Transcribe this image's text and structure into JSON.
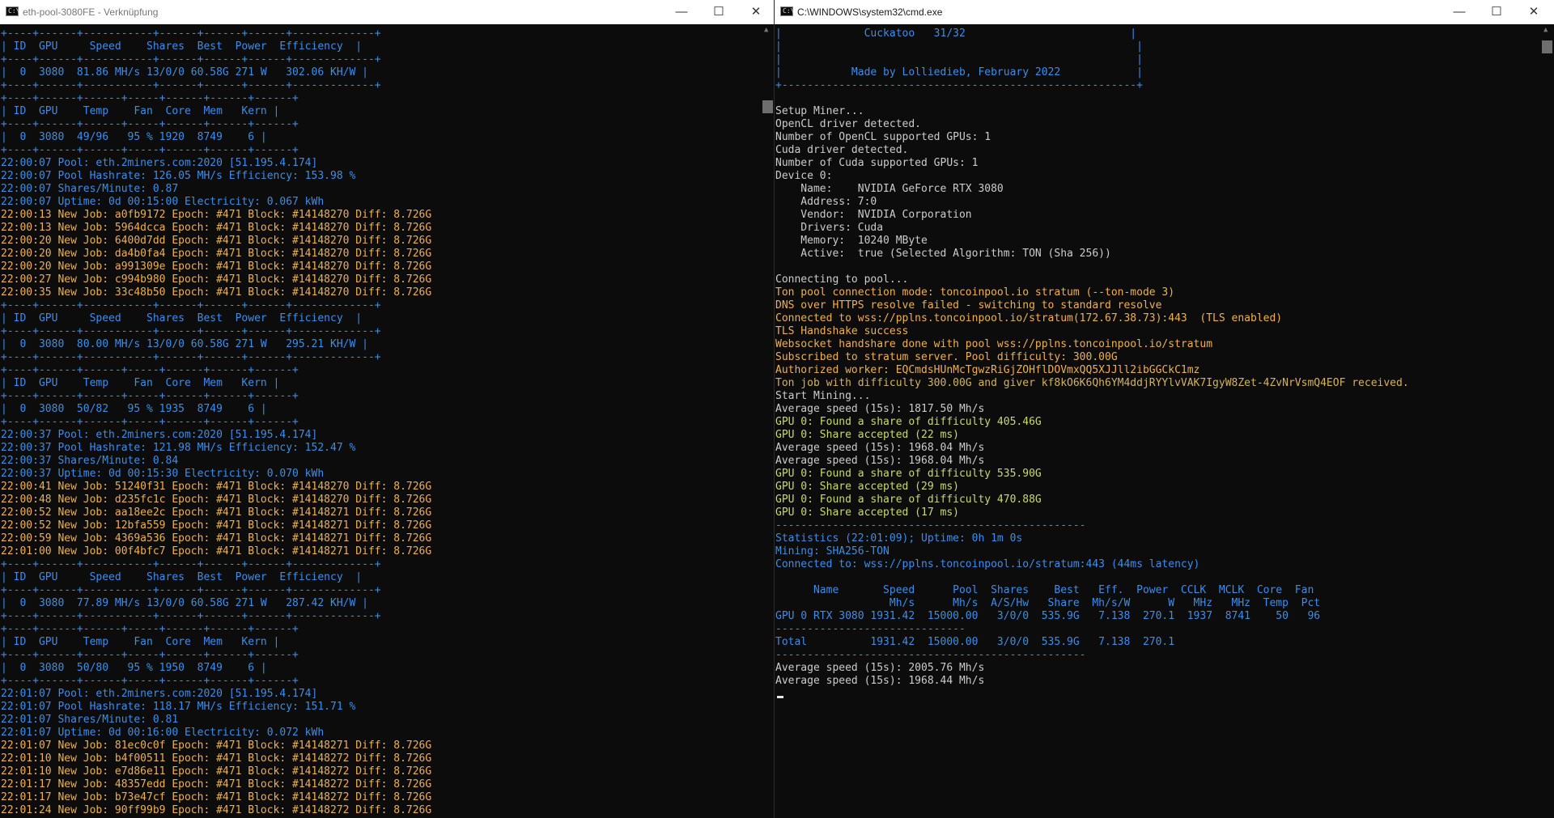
{
  "left_window": {
    "title": "eth-pool-3080FE - Verknüpfung",
    "controls": {
      "minimize": "—",
      "maximize": "☐",
      "close": "✕"
    },
    "lines": [
      {
        "t": "+----+------+-----------+------+------+------+-------------+",
        "c": "blue"
      },
      {
        "t": "| ID  GPU     Speed    Shares  Best  Power  Efficiency  |",
        "c": "blue"
      },
      {
        "t": "+----+------+-----------+------+------+------+-------------+",
        "c": "blue"
      },
      {
        "t": "|  0  3080  81.86 MH/s 13/0/0 60.58G 271 W   302.06 KH/W |",
        "c": "blue"
      },
      {
        "t": "+----+------+-----------+------+------+------+-------------+",
        "c": "blue"
      },
      {
        "t": "+----+------+------+-----+------+------+------+",
        "c": "blue"
      },
      {
        "t": "| ID  GPU    Temp    Fan  Core  Mem   Kern |",
        "c": "blue"
      },
      {
        "t": "+----+------+------+-----+------+------+------+",
        "c": "blue"
      },
      {
        "t": "|  0  3080  49/96   95 % 1920  8749    6 |",
        "c": "blue"
      },
      {
        "t": "+----+------+------+-----+------+------+------+",
        "c": "blue"
      },
      {
        "t": "22:00:07 Pool: eth.2miners.com:2020 [51.195.4.174]",
        "c": "blue"
      },
      {
        "t": "22:00:07 Pool Hashrate: 126.05 MH/s Efficiency: 153.98 %",
        "c": "blue"
      },
      {
        "t": "22:00:07 Shares/Minute: 0.87",
        "c": "blue"
      },
      {
        "t": "22:00:07 Uptime: 0d 00:15:00 Electricity: 0.067 kWh",
        "c": "blue"
      },
      {
        "t": "22:00:13 New Job: a0fb9172 Epoch: #471 Block: #14148270 Diff: 8.726G",
        "c": "yellow"
      },
      {
        "t": "22:00:13 New Job: 5964dcca Epoch: #471 Block: #14148270 Diff: 8.726G",
        "c": "yellow"
      },
      {
        "t": "22:00:20 New Job: 6400d7dd Epoch: #471 Block: #14148270 Diff: 8.726G",
        "c": "yellow"
      },
      {
        "t": "22:00:20 New Job: da4b0fa4 Epoch: #471 Block: #14148270 Diff: 8.726G",
        "c": "yellow"
      },
      {
        "t": "22:00:20 New Job: a991309e Epoch: #471 Block: #14148270 Diff: 8.726G",
        "c": "yellow"
      },
      {
        "t": "22:00:27 New Job: c994b980 Epoch: #471 Block: #14148270 Diff: 8.726G",
        "c": "yellow"
      },
      {
        "t": "22:00:35 New Job: 33c48b50 Epoch: #471 Block: #14148270 Diff: 8.726G",
        "c": "yellow"
      },
      {
        "t": "+----+------+-----------+------+------+------+-------------+",
        "c": "blue"
      },
      {
        "t": "| ID  GPU     Speed    Shares  Best  Power  Efficiency  |",
        "c": "blue"
      },
      {
        "t": "+----+------+-----------+------+------+------+-------------+",
        "c": "blue"
      },
      {
        "t": "|  0  3080  80.00 MH/s 13/0/0 60.58G 271 W   295.21 KH/W |",
        "c": "blue"
      },
      {
        "t": "+----+------+-----------+------+------+------+-------------+",
        "c": "blue"
      },
      {
        "t": "+----+------+------+-----+------+------+------+",
        "c": "blue"
      },
      {
        "t": "| ID  GPU    Temp    Fan  Core  Mem   Kern |",
        "c": "blue"
      },
      {
        "t": "+----+------+------+-----+------+------+------+",
        "c": "blue"
      },
      {
        "t": "|  0  3080  50/82   95 % 1935  8749    6 |",
        "c": "blue"
      },
      {
        "t": "+----+------+------+-----+------+------+------+",
        "c": "blue"
      },
      {
        "t": "22:00:37 Pool: eth.2miners.com:2020 [51.195.4.174]",
        "c": "blue"
      },
      {
        "t": "22:00:37 Pool Hashrate: 121.98 MH/s Efficiency: 152.47 %",
        "c": "blue"
      },
      {
        "t": "22:00:37 Shares/Minute: 0.84",
        "c": "blue"
      },
      {
        "t": "22:00:37 Uptime: 0d 00:15:30 Electricity: 0.070 kWh",
        "c": "blue"
      },
      {
        "t": "22:00:41 New Job: 51240f31 Epoch: #471 Block: #14148270 Diff: 8.726G",
        "c": "yellow"
      },
      {
        "t": "22:00:48 New Job: d235fc1c Epoch: #471 Block: #14148270 Diff: 8.726G",
        "c": "yellow"
      },
      {
        "t": "22:00:52 New Job: aa18ee2c Epoch: #471 Block: #14148271 Diff: 8.726G",
        "c": "yellow"
      },
      {
        "t": "22:00:52 New Job: 12bfa559 Epoch: #471 Block: #14148271 Diff: 8.726G",
        "c": "yellow"
      },
      {
        "t": "22:00:59 New Job: 4369a536 Epoch: #471 Block: #14148271 Diff: 8.726G",
        "c": "yellow"
      },
      {
        "t": "22:01:00 New Job: 00f4bfc7 Epoch: #471 Block: #14148271 Diff: 8.726G",
        "c": "yellow"
      },
      {
        "t": "+----+------+-----------+------+------+------+-------------+",
        "c": "blue"
      },
      {
        "t": "| ID  GPU     Speed    Shares  Best  Power  Efficiency  |",
        "c": "blue"
      },
      {
        "t": "+----+------+-----------+------+------+------+-------------+",
        "c": "blue"
      },
      {
        "t": "|  0  3080  77.89 MH/s 13/0/0 60.58G 271 W   287.42 KH/W |",
        "c": "blue"
      },
      {
        "t": "+----+------+-----------+------+------+------+-------------+",
        "c": "blue"
      },
      {
        "t": "+----+------+------+-----+------+------+------+",
        "c": "blue"
      },
      {
        "t": "| ID  GPU    Temp    Fan  Core  Mem   Kern |",
        "c": "blue"
      },
      {
        "t": "+----+------+------+-----+------+------+------+",
        "c": "blue"
      },
      {
        "t": "|  0  3080  50/80   95 % 1950  8749    6 |",
        "c": "blue"
      },
      {
        "t": "+----+------+------+-----+------+------+------+",
        "c": "blue"
      },
      {
        "t": "22:01:07 Pool: eth.2miners.com:2020 [51.195.4.174]",
        "c": "blue"
      },
      {
        "t": "22:01:07 Pool Hashrate: 118.17 MH/s Efficiency: 151.71 %",
        "c": "blue"
      },
      {
        "t": "22:01:07 Shares/Minute: 0.81",
        "c": "blue"
      },
      {
        "t": "22:01:07 Uptime: 0d 00:16:00 Electricity: 0.072 kWh",
        "c": "blue"
      },
      {
        "t": "22:01:07 New Job: 81ec0c0f Epoch: #471 Block: #14148271 Diff: 8.726G",
        "c": "yellow"
      },
      {
        "t": "22:01:10 New Job: b4f00511 Epoch: #471 Block: #14148272 Diff: 8.726G",
        "c": "yellow"
      },
      {
        "t": "22:01:10 New Job: e7d86e11 Epoch: #471 Block: #14148272 Diff: 8.726G",
        "c": "yellow"
      },
      {
        "t": "22:01:17 New Job: 48357edd Epoch: #471 Block: #14148272 Diff: 8.726G",
        "c": "yellow"
      },
      {
        "t": "22:01:17 New Job: b73e47cf Epoch: #471 Block: #14148272 Diff: 8.726G",
        "c": "yellow"
      },
      {
        "t": "22:01:24 New Job: 90ff99b9 Epoch: #471 Block: #14148272 Diff: 8.726G",
        "c": "yellow"
      }
    ]
  },
  "right_window": {
    "title": "C:\\WINDOWS\\system32\\cmd.exe",
    "controls": {
      "minimize": "—",
      "maximize": "☐",
      "close": "✕"
    },
    "lines": [
      {
        "t": "|             Cuckatoo   31/32                          |",
        "c": "blue"
      },
      {
        "t": "|                                                        |",
        "c": "blue"
      },
      {
        "t": "|                                                        |",
        "c": "blue"
      },
      {
        "t": "|           Made by Lolliedieb, February 2022            |",
        "c": "blue"
      },
      {
        "t": "+--------------------------------------------------------+",
        "c": "blue"
      },
      {
        "t": "",
        "c": "grey"
      },
      {
        "t": "Setup Miner...",
        "c": "grey"
      },
      {
        "t": "OpenCL driver detected.",
        "c": "grey"
      },
      {
        "t": "Number of OpenCL supported GPUs: 1",
        "c": "grey"
      },
      {
        "t": "Cuda driver detected.",
        "c": "grey"
      },
      {
        "t": "Number of Cuda supported GPUs: 1",
        "c": "grey"
      },
      {
        "t": "Device 0:",
        "c": "grey"
      },
      {
        "t": "    Name:    NVIDIA GeForce RTX 3080",
        "c": "grey"
      },
      {
        "t": "    Address: 7:0",
        "c": "grey"
      },
      {
        "t": "    Vendor:  NVIDIA Corporation",
        "c": "grey"
      },
      {
        "t": "    Drivers: Cuda",
        "c": "grey"
      },
      {
        "t": "    Memory:  10240 MByte",
        "c": "grey"
      },
      {
        "t": "    Active:  true (Selected Algorithm: TON (Sha 256))",
        "c": "grey"
      },
      {
        "t": "",
        "c": "grey"
      },
      {
        "t": "Connecting to pool...",
        "c": "grey"
      },
      {
        "t": "Ton pool connection mode: toncoinpool.io stratum (--ton-mode 3)",
        "c": "yellow"
      },
      {
        "t": "DNS over HTTPS resolve failed - switching to standard resolve",
        "c": "yellow"
      },
      {
        "t": "Connected to wss://pplns.toncoinpool.io/stratum(172.67.38.73):443  (TLS enabled)",
        "c": "yellow"
      },
      {
        "t": "TLS Handshake success",
        "c": "yellow"
      },
      {
        "t": "Websocket handshare done with pool wss://pplns.toncoinpool.io/stratum",
        "c": "yellow"
      },
      {
        "t": "Subscribed to stratum server. Pool difficulty: 300.00G",
        "c": "yellow"
      },
      {
        "t": "Authorized worker: EQCmdsHUnMcTgwzRiGjZOHflDOVmxQQ5XJJll2ibGGCkC1mz",
        "c": "yellow"
      },
      {
        "t": "Ton job with difficulty 300.00G and giver kf8kO6K6Qh6YM4ddjRYYlvVAK7IgyW8Zet-4ZvNrVsmQ4EOF received.",
        "c": "orange"
      },
      {
        "t": "Start Mining...",
        "c": "grey"
      },
      {
        "t": "Average speed (15s): 1817.50 Mh/s",
        "c": "grey"
      },
      {
        "t": "GPU 0: Found a share of difficulty 405.46G",
        "c": "lime"
      },
      {
        "t": "GPU 0: Share accepted (22 ms)",
        "c": "lime"
      },
      {
        "t": "Average speed (15s): 1968.04 Mh/s",
        "c": "grey"
      },
      {
        "t": "Average speed (15s): 1968.04 Mh/s",
        "c": "grey"
      },
      {
        "t": "GPU 0: Found a share of difficulty 535.90G",
        "c": "lime"
      },
      {
        "t": "GPU 0: Share accepted (29 ms)",
        "c": "lime"
      },
      {
        "t": "GPU 0: Found a share of difficulty 470.88G",
        "c": "lime"
      },
      {
        "t": "GPU 0: Share accepted (17 ms)",
        "c": "lime"
      },
      {
        "t": "-------------------------------------------------",
        "c": "blue"
      },
      {
        "t": "Statistics (22:01:09); Uptime: 0h 1m 0s",
        "c": "blue"
      },
      {
        "t": "Mining: SHA256-TON",
        "c": "blue"
      },
      {
        "t": "Connected to: wss://pplns.toncoinpool.io/stratum:443 (44ms latency)",
        "c": "blue"
      },
      {
        "t": "",
        "c": "grey"
      },
      {
        "t": "      Name       Speed      Pool  Shares    Best   Eff.  Power  CCLK  MCLK  Core  Fan",
        "c": "blue"
      },
      {
        "t": "                  Mh/s      Mh/s  A/S/Hw   Share  Mh/s/W      W   MHz   MHz  Temp  Pct",
        "c": "blue"
      },
      {
        "t": "GPU 0 RTX 3080 1931.42  15000.00   3/0/0  535.9G   7.138  270.1  1937  8741    50   96",
        "c": "blue"
      },
      {
        "t": "------------------------------",
        "c": "blue"
      },
      {
        "t": "Total          1931.42  15000.00   3/0/0  535.9G   7.138  270.1",
        "c": "blue"
      },
      {
        "t": "-------------------------------------------------",
        "c": "blue"
      },
      {
        "t": "Average speed (15s): 2005.76 Mh/s",
        "c": "grey"
      },
      {
        "t": "Average speed (15s): 1968.44 Mh/s",
        "c": "grey"
      }
    ]
  },
  "colors": {
    "blue": "#3b8eea",
    "yellow": "#f0b14b",
    "grey": "#cccccc",
    "lime": "#c8dc6a",
    "orange": "#d6b25b",
    "green": "#7ed957",
    "dkgreen": "#13a10e"
  }
}
